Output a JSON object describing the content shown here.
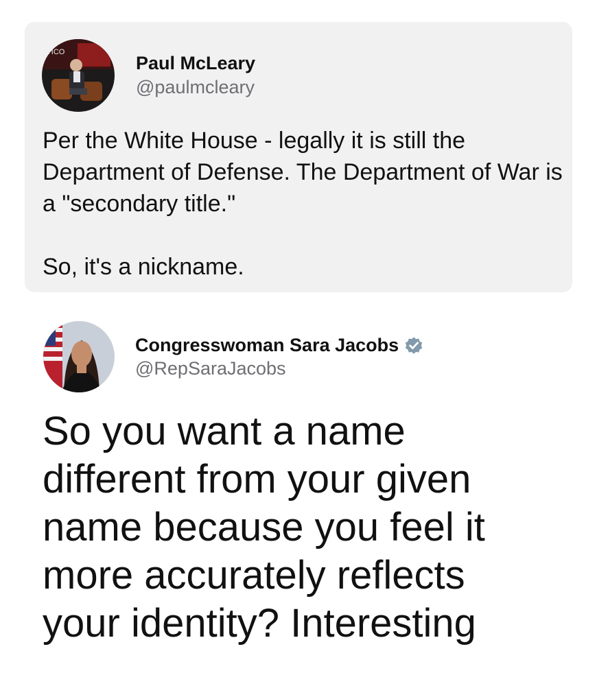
{
  "quoted_post": {
    "author_name": "Paul McLeary",
    "author_handle": "@paulmcleary",
    "avatar_backdrop_text": "ITICO",
    "paragraphs": [
      "Per the White House - legally it is still the Department of Defense. The Department of War is a \"secondary title.\"",
      "So, it's a nickname."
    ]
  },
  "main_post": {
    "author_name": "Congresswoman Sara Jacobs",
    "author_handle": "@RepSaraJacobs",
    "verified_badge_icon": "verified-check-icon",
    "verified_badge_color": "#829aab",
    "text": "So you want a name\ndifferent from your given\nname because you feel it\nmore accurately reflects\nyour identity? Interesting"
  },
  "colors": {
    "card_background": "#f1f1f2",
    "handle_gray": "#6e6e73",
    "text": "#111111"
  }
}
